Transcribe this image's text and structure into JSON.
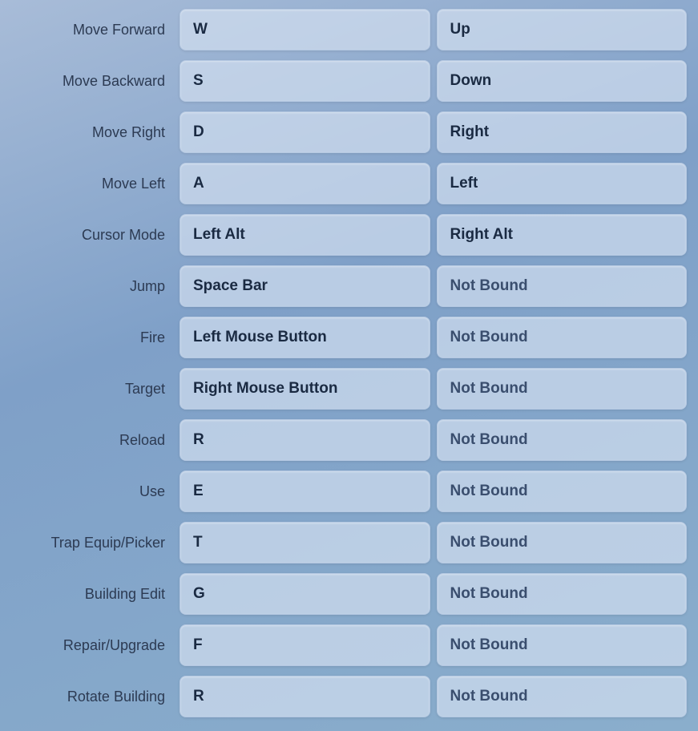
{
  "rows": [
    {
      "action": "Move Forward",
      "primary": "W",
      "secondary": "Up"
    },
    {
      "action": "Move Backward",
      "primary": "S",
      "secondary": "Down"
    },
    {
      "action": "Move Right",
      "primary": "D",
      "secondary": "Right"
    },
    {
      "action": "Move Left",
      "primary": "A",
      "secondary": "Left"
    },
    {
      "action": "Cursor Mode",
      "primary": "Left Alt",
      "secondary": "Right Alt"
    },
    {
      "action": "Jump",
      "primary": "Space Bar",
      "secondary": "Not Bound"
    },
    {
      "action": "Fire",
      "primary": "Left Mouse Button",
      "secondary": "Not Bound"
    },
    {
      "action": "Target",
      "primary": "Right Mouse Button",
      "secondary": "Not Bound"
    },
    {
      "action": "Reload",
      "primary": "R",
      "secondary": "Not Bound"
    },
    {
      "action": "Use",
      "primary": "E",
      "secondary": "Not Bound"
    },
    {
      "action": "Trap Equip/Picker",
      "primary": "T",
      "secondary": "Not Bound"
    },
    {
      "action": "Building Edit",
      "primary": "G",
      "secondary": "Not Bound"
    },
    {
      "action": "Repair/Upgrade",
      "primary": "F",
      "secondary": "Not Bound"
    },
    {
      "action": "Rotate Building",
      "primary": "R",
      "secondary": "Not Bound"
    }
  ]
}
